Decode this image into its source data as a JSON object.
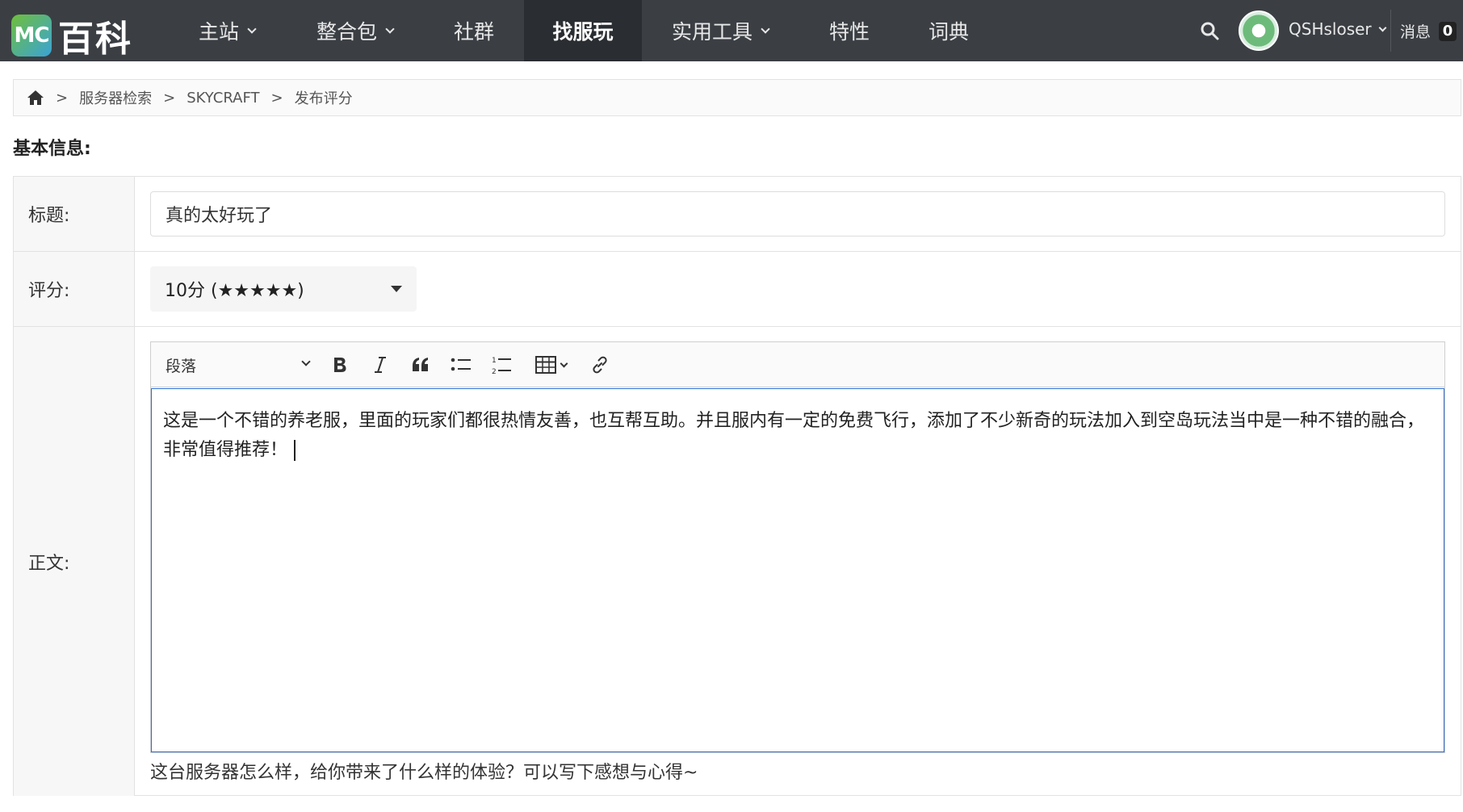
{
  "brand": {
    "badge": "MC",
    "name": "百科"
  },
  "nav": {
    "items": [
      {
        "label": "主站",
        "dropdown": true
      },
      {
        "label": "整合包",
        "dropdown": true
      },
      {
        "label": "社群",
        "dropdown": false
      },
      {
        "label": "找服玩",
        "dropdown": false,
        "active": true
      },
      {
        "label": "实用工具",
        "dropdown": true
      },
      {
        "label": "特性",
        "dropdown": false
      },
      {
        "label": "词典",
        "dropdown": false
      }
    ],
    "username": "QSHsloser",
    "messages_label": "消息",
    "messages_count": "0"
  },
  "breadcrumb": {
    "items": [
      "服务器检索",
      "SKYCRAFT",
      "发布评分"
    ],
    "separator": ">"
  },
  "section_title": "基本信息:",
  "form": {
    "title_label": "标题:",
    "title_value": "真的太好玩了",
    "score_label": "评分:",
    "score_value": "10分 (★★★★★)",
    "body_label": "正文:",
    "paragraph_select": "段落",
    "content": "这是一个不错的养老服，里面的玩家们都很热情友善，也互帮互助。并且服内有一定的免费飞行，添加了不少新奇的玩法加入到空岛玩法当中是一种不错的融合，非常值得推荐！",
    "hint": "这台服务器怎么样，给你带来了什么样的体验？可以写下感想与心得~"
  },
  "colors": {
    "navbar": "#3b3f44",
    "navbar_active": "#2a2d31",
    "editor_focus": "#2d6fd3"
  }
}
